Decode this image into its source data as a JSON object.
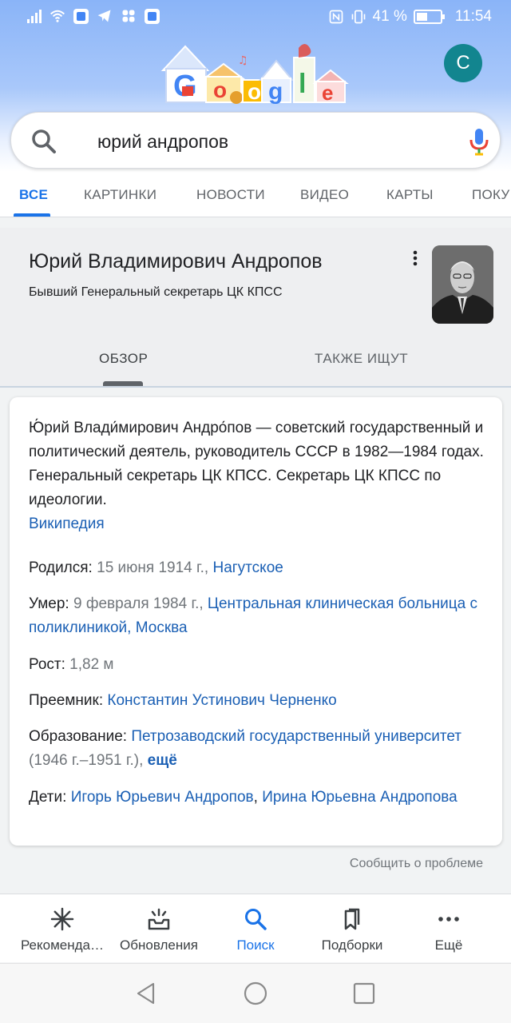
{
  "status_bar": {
    "battery_percent": "41 %",
    "time": "11:54"
  },
  "account": {
    "initial": "C",
    "color": "#12858f"
  },
  "doodle": {
    "word": "Google"
  },
  "search": {
    "query": "юрий андропов"
  },
  "tabs": [
    {
      "label": "ВСЕ",
      "active": true
    },
    {
      "label": "КАРТИНКИ"
    },
    {
      "label": "НОВОСТИ"
    },
    {
      "label": "ВИДЕО"
    },
    {
      "label": "КАРТЫ"
    },
    {
      "label": "ПОКУ"
    }
  ],
  "knowledge_panel": {
    "title": "Юрий Владимирович Андропов",
    "subtitle": "Бывший Генеральный секретарь ЦК КПСС",
    "tabs": [
      "ОБЗОР",
      "ТАКЖЕ ИЩУТ"
    ],
    "description": "Ю́рий Влади́мирович Андро́пов — советский государственный и политический деятель, руководитель СССР в 1982—1984 годах. Генеральный секретарь ЦК КПСС. Секретарь ЦК КПСС по идеологии.",
    "source_link": "Википедия",
    "facts": {
      "born_label": "Родился:",
      "born_date": "15 июня 1914 г.,",
      "born_place": "Нагутское",
      "died_label": "Умер:",
      "died_date": "9 февраля 1984 г.,",
      "died_place": "Центральная клиническая больница с поликлиникой, Москва",
      "height_label": "Рост:",
      "height_value": "1,82 м",
      "successor_label": "Преемник:",
      "successor_value": "Константин Устинович Черненко",
      "education_label": "Образование:",
      "education_value": "Петрозаводский государственный университет",
      "education_years": "(1946 г.–1951 г.),",
      "education_more": "ещё",
      "children_label": "Дети:",
      "child_1": "Игорь Юрьевич Андропов",
      "child_2": "Ирина Юрьевна Андропова"
    }
  },
  "report_link": "Сообщить о проблеме",
  "bottom_nav": [
    {
      "label": "Рекоменда…",
      "icon": "asterisk-icon"
    },
    {
      "label": "Обновления",
      "icon": "inbox-updates-icon"
    },
    {
      "label": "Поиск",
      "icon": "search-icon",
      "active": true
    },
    {
      "label": "Подборки",
      "icon": "collections-icon"
    },
    {
      "label": "Ещё",
      "icon": "more-horizontal-icon"
    }
  ],
  "colors": {
    "accent": "#1a73e8",
    "link": "#1a5fb4",
    "header_gradient_top": "#8ab4f8"
  }
}
